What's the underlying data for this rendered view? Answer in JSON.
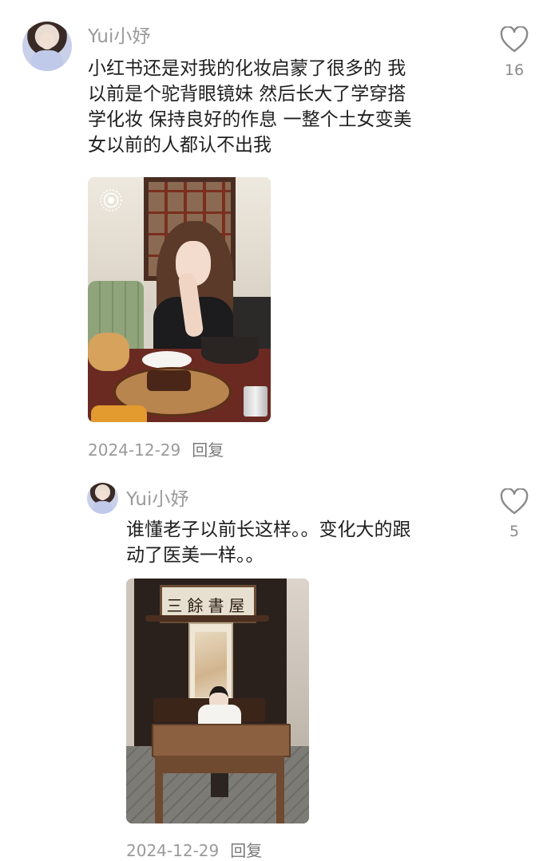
{
  "comments": [
    {
      "username": "Yui小妤",
      "text_lines": [
        "小红书还是对我的化妆启蒙了很多的 我",
        "以前是个驼背眼镜妹 然后长大了学穿搭",
        "学化妆 保持良好的作息 一整个土女变美",
        "女以前的人都认不出我"
      ],
      "likes": "16",
      "date": "2024-12-29",
      "reply_label": "回复"
    },
    {
      "username": "Yui小妤",
      "text_lines": [
        "谁懂老子以前长这样。。变化大的跟",
        "动了医美一样。。"
      ],
      "likes": "5",
      "date": "2024-12-29",
      "reply_label": "回复",
      "photo_plaque": "三餘書屋"
    }
  ],
  "colors": {
    "username": "#9a9a9a",
    "text": "#1f1f1f",
    "meta": "#9a9a9a",
    "heart_stroke": "#8a8a8a"
  }
}
